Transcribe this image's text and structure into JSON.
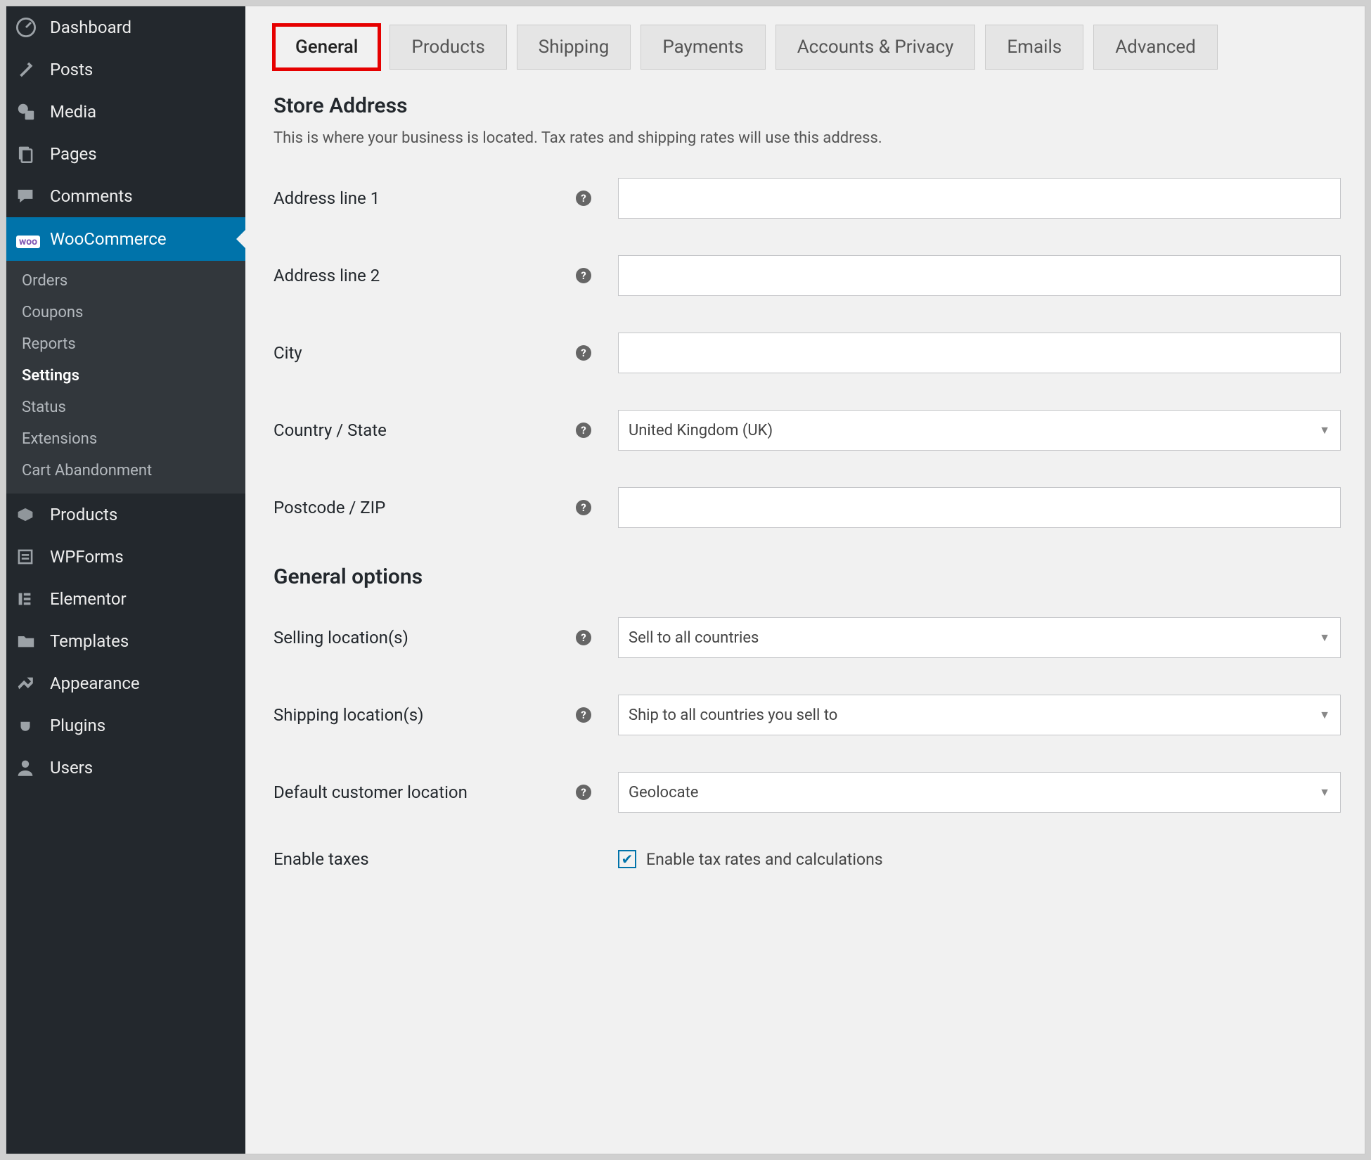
{
  "sidebar": {
    "items": [
      {
        "key": "dashboard",
        "label": "Dashboard"
      },
      {
        "key": "posts",
        "label": "Posts"
      },
      {
        "key": "media",
        "label": "Media"
      },
      {
        "key": "pages",
        "label": "Pages"
      },
      {
        "key": "comments",
        "label": "Comments"
      },
      {
        "key": "woocommerce",
        "label": "WooCommerce",
        "current": true,
        "badge": "woo"
      },
      {
        "key": "products",
        "label": "Products"
      },
      {
        "key": "wpforms",
        "label": "WPForms"
      },
      {
        "key": "elementor",
        "label": "Elementor"
      },
      {
        "key": "templates",
        "label": "Templates"
      },
      {
        "key": "appearance",
        "label": "Appearance"
      },
      {
        "key": "plugins",
        "label": "Plugins"
      },
      {
        "key": "users",
        "label": "Users"
      }
    ],
    "woocommerce_sub": [
      {
        "label": "Orders"
      },
      {
        "label": "Coupons"
      },
      {
        "label": "Reports"
      },
      {
        "label": "Settings",
        "active": true
      },
      {
        "label": "Status"
      },
      {
        "label": "Extensions"
      },
      {
        "label": "Cart Abandonment"
      }
    ]
  },
  "tabs": [
    {
      "label": "General",
      "active": true,
      "highlight": true
    },
    {
      "label": "Products"
    },
    {
      "label": "Shipping"
    },
    {
      "label": "Payments"
    },
    {
      "label": "Accounts & Privacy"
    },
    {
      "label": "Emails"
    },
    {
      "label": "Advanced"
    }
  ],
  "sections": {
    "store_address": {
      "heading": "Store Address",
      "desc": "This is where your business is located. Tax rates and shipping rates will use this address.",
      "fields": {
        "address1": {
          "label": "Address line 1",
          "value": ""
        },
        "address2": {
          "label": "Address line 2",
          "value": ""
        },
        "city": {
          "label": "City",
          "value": ""
        },
        "country": {
          "label": "Country / State",
          "value": "United Kingdom (UK)"
        },
        "postcode": {
          "label": "Postcode / ZIP",
          "value": ""
        }
      }
    },
    "general_options": {
      "heading": "General options",
      "fields": {
        "selling": {
          "label": "Selling location(s)",
          "value": "Sell to all countries"
        },
        "shipping": {
          "label": "Shipping location(s)",
          "value": "Ship to all countries you sell to"
        },
        "default_loc": {
          "label": "Default customer location",
          "value": "Geolocate"
        },
        "enable_taxes": {
          "label": "Enable taxes",
          "checkbox_label": "Enable tax rates and calculations",
          "checked": true
        }
      }
    }
  }
}
